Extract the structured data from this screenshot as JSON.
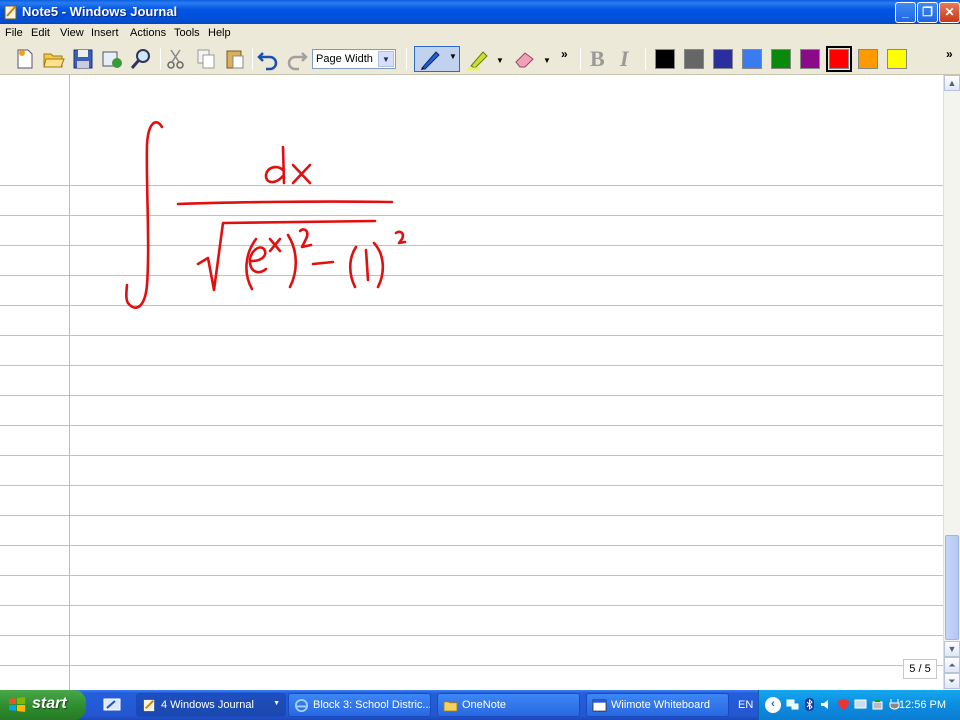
{
  "window": {
    "title": "Note5 - Windows Journal",
    "minimize": "_",
    "maximize": "❐",
    "close": "✕"
  },
  "menu": {
    "items": [
      "File",
      "Edit",
      "View",
      "Insert",
      "Actions",
      "Tools",
      "Help"
    ]
  },
  "toolbar": {
    "zoom_value": "Page Width",
    "overflow": "»",
    "bold_label": "B",
    "italic_label": "I",
    "colors": [
      "#000000",
      "#666666",
      "#2b2f9e",
      "#3a7bf0",
      "#0a8a0a",
      "#8a0a8a",
      "#ff0000",
      "#ff9900",
      "#ffff00"
    ],
    "selected_color": "#ff0000"
  },
  "page": {
    "page_indicator": "5 / 5",
    "ink_color": "#e01010"
  },
  "taskbar": {
    "start_label": "start",
    "tasks": [
      "4 Windows Journal",
      "Block 3: School Distric...",
      "OneNote",
      "Wiimote Whiteboard"
    ],
    "language": "EN",
    "clock": "12:56 PM"
  }
}
